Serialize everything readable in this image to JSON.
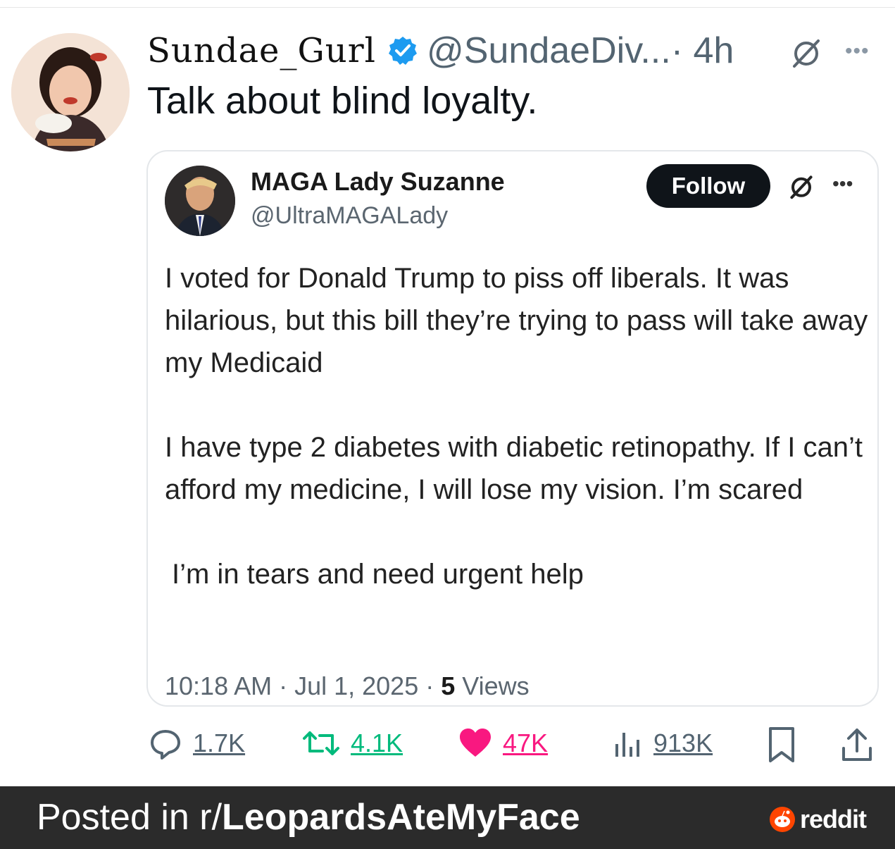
{
  "tweet": {
    "display_name": "Sundae_Gurl",
    "handle": "@SundaeDiv...",
    "time": " · 4h",
    "text": "Talk about blind loyalty."
  },
  "quoted": {
    "name": "MAGA Lady Suzanne",
    "handle": "@UltraMAGALady",
    "follow_label": "Follow",
    "paragraphs": [
      "I voted for Donald Trump to piss off liberals. It was hilarious, but this bill they’re trying to pass will take away my Medicaid",
      "I have type 2 diabetes with diabetic retinopathy. If I can’t afford my medicine, I will lose my vision. I’m scared",
      "I’m in tears and need urgent help"
    ],
    "meta_time": "10:18 AM · Jul 1, 2025 · ",
    "views_count": "5",
    "views_label": " Views"
  },
  "actions": {
    "replies": "1.7K",
    "reposts": "4.1K",
    "likes": "47K",
    "views": "913K"
  },
  "colors": {
    "retweet": "#00ba7c",
    "like": "#f91880",
    "verified": "#1d9bf0",
    "reddit": "#ff4500"
  },
  "footer": {
    "prefix": "Posted in r/",
    "subreddit": "LeopardsAteMyFace",
    "brand": "reddit"
  }
}
